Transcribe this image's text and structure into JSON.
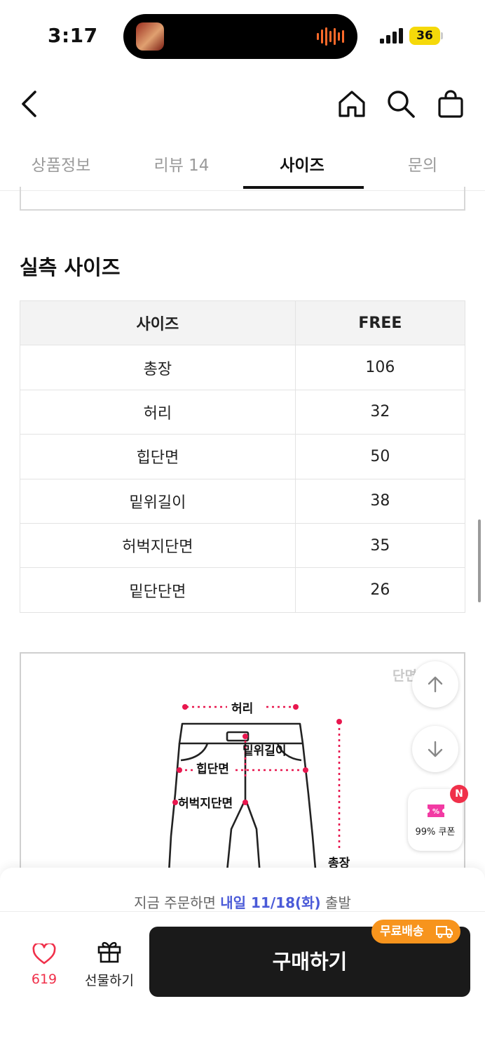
{
  "status_bar": {
    "time": "3:17",
    "battery": "36"
  },
  "header": {
    "back_icon": "chevron-left-icon",
    "home_icon": "home-icon",
    "search_icon": "search-icon",
    "cart_icon": "shopping-bag-icon"
  },
  "tabs": [
    {
      "label": "상품정보",
      "active": false
    },
    {
      "label": "리뷰 14",
      "active": false
    },
    {
      "label": "사이즈",
      "active": true
    },
    {
      "label": "문의",
      "active": false
    }
  ],
  "size_section": {
    "title": "실측 사이즈",
    "columns": [
      "사이즈",
      "FREE"
    ],
    "rows": [
      [
        "총장",
        "106"
      ],
      [
        "허리",
        "32"
      ],
      [
        "힙단면",
        "50"
      ],
      [
        "밑위길이",
        "38"
      ],
      [
        "허벅지단면",
        "35"
      ],
      [
        "밑단단면",
        "26"
      ]
    ]
  },
  "diagram": {
    "corner_label": "단면",
    "labels": {
      "waist": "허리",
      "rise": "밑위길이",
      "hip": "힙단면",
      "thigh": "허벅지단면",
      "length": "총장"
    },
    "accent_color": "#e8174e"
  },
  "floating": {
    "up_icon": "arrow-up-icon",
    "down_icon": "arrow-down-icon",
    "coupon_label": "99% 쿠폰",
    "coupon_badge": "N"
  },
  "bottom_bar": {
    "ship_prefix": "지금 주문하면 ",
    "ship_highlight": "내일 11/18(화)",
    "ship_suffix": " 출발",
    "like_count": "619",
    "gift_label": "선물하기",
    "buy_label": "구매하기",
    "free_shipping_badge": "무료배송",
    "colors": {
      "like": "#f0304a",
      "badge": "#f7941d",
      "highlight": "#4a5ad8",
      "buy": "#1a1a1a"
    }
  }
}
